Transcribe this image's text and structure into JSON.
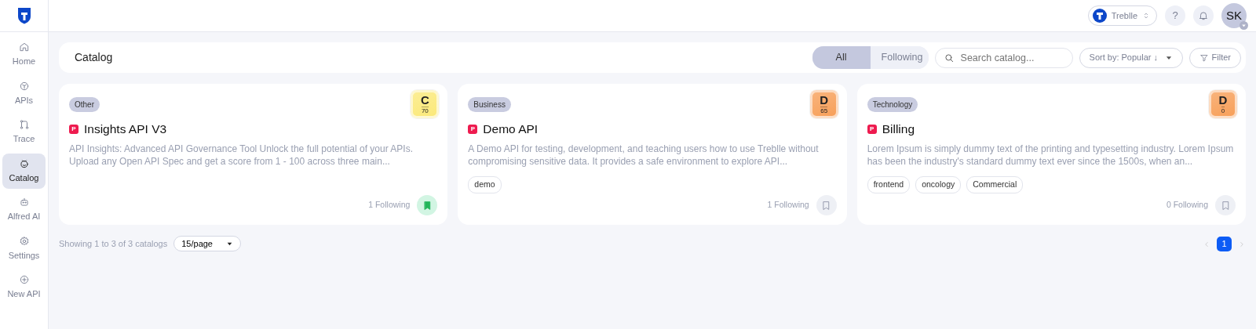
{
  "header": {
    "workspace": "Treblle",
    "help": "?",
    "avatar": "SK"
  },
  "sidebar": {
    "items": [
      {
        "label": "Home",
        "selected": false
      },
      {
        "label": "APIs",
        "selected": false
      },
      {
        "label": "Trace",
        "selected": false
      },
      {
        "label": "Catalog",
        "selected": true
      },
      {
        "label": "Alfred AI",
        "selected": false
      },
      {
        "label": "Settings",
        "selected": false
      },
      {
        "label": "New API",
        "selected": false
      }
    ]
  },
  "toolbar": {
    "title": "Catalog",
    "tabs": [
      {
        "label": "All",
        "selected": true
      },
      {
        "label": "Following",
        "selected": false
      }
    ],
    "search": {
      "placeholder": "Search catalog..."
    },
    "sort": "Sort by: Popular ↓",
    "filter": "Filter"
  },
  "cards": [
    {
      "category": "Other",
      "grade": "C",
      "score": "70",
      "color": "#fbe97a",
      "badge": "P",
      "title": "Insights API V3",
      "description": "API Insights: Advanced API Governance Tool Unlock the full potential of your APIs. Upload any Open API Spec and get a score from 1 - 100 across three main...",
      "following": "1 Following",
      "followed": true
    },
    {
      "category": "Business",
      "grade": "D",
      "score": "65",
      "color": "#f7a05a",
      "badge": "P",
      "title": "Demo API",
      "description": "A Demo API for testing, development, and teaching users how to use Treblle without compromising sensitive data. It provides a safe environment to explore API...",
      "tags": [
        "demo"
      ],
      "following": "1 Following",
      "followed": false
    },
    {
      "category": "Technology",
      "grade": "D",
      "score": "0",
      "color": "#f7a05a",
      "badge": "P",
      "title": "Billing",
      "description": "Lorem Ipsum is simply dummy text of the printing and typesetting industry. Lorem Ipsum has been the industry's standard dummy text ever since the 1500s, when an...",
      "tags": [
        "frontend",
        "oncology",
        "Commercial"
      ],
      "following": "0 Following",
      "followed": false
    }
  ],
  "footer": {
    "showing": "Showing 1 to 3 of 3 catalogs",
    "page_size": "15/page",
    "pages": [
      {
        "label": "1",
        "selected": true
      }
    ]
  }
}
